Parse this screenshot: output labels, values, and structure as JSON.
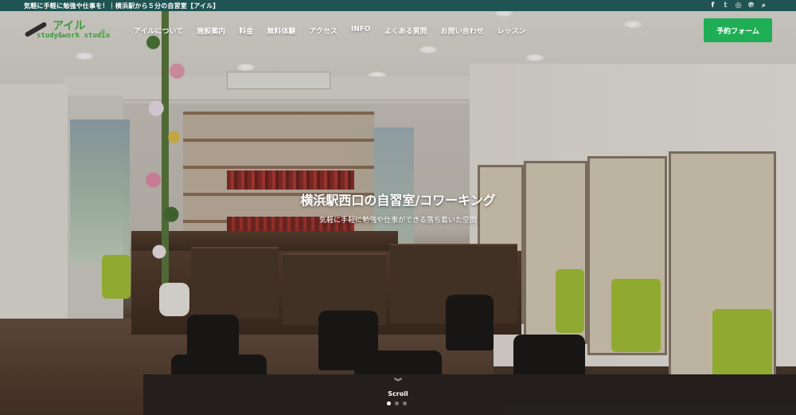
{
  "topbar": {
    "tagline": "気軽に手軽に勉強や仕事を！｜横浜駅から５分の自習室【アイル】",
    "social": [
      {
        "icon": "facebook-icon",
        "glyph": "f"
      },
      {
        "icon": "twitter-icon",
        "glyph": "𝕥"
      },
      {
        "icon": "instagram-icon",
        "glyph": "◎"
      },
      {
        "icon": "pinterest-icon",
        "glyph": "℗"
      },
      {
        "icon": "search-icon",
        "glyph": "⌕"
      }
    ]
  },
  "logo": {
    "main": "アイル",
    "sub": "study&work studio",
    "mark": "®"
  },
  "nav": {
    "items": [
      {
        "label": "アイルについて"
      },
      {
        "label": "施設案内"
      },
      {
        "label": "料金"
      },
      {
        "label": "無料体験"
      },
      {
        "label": "アクセス"
      },
      {
        "label": "INFO"
      },
      {
        "label": "よくある質問"
      },
      {
        "label": "お問い合わせ"
      },
      {
        "label": "レッスン"
      }
    ],
    "cta_label": "予約フォーム"
  },
  "hero": {
    "title": "横浜駅西口の自習室/コワーキング",
    "subtitle": "気軽に手軽に勉強や仕事ができる落ち着いた空間",
    "scroll_glyph": "︾",
    "scroll_label": "Scroll",
    "slide_count": 3,
    "active_slide": 1
  },
  "colors": {
    "topbar_bg": "#1f5452",
    "cta_bg": "#1fae55",
    "logo_green": "#3f9a3a"
  }
}
